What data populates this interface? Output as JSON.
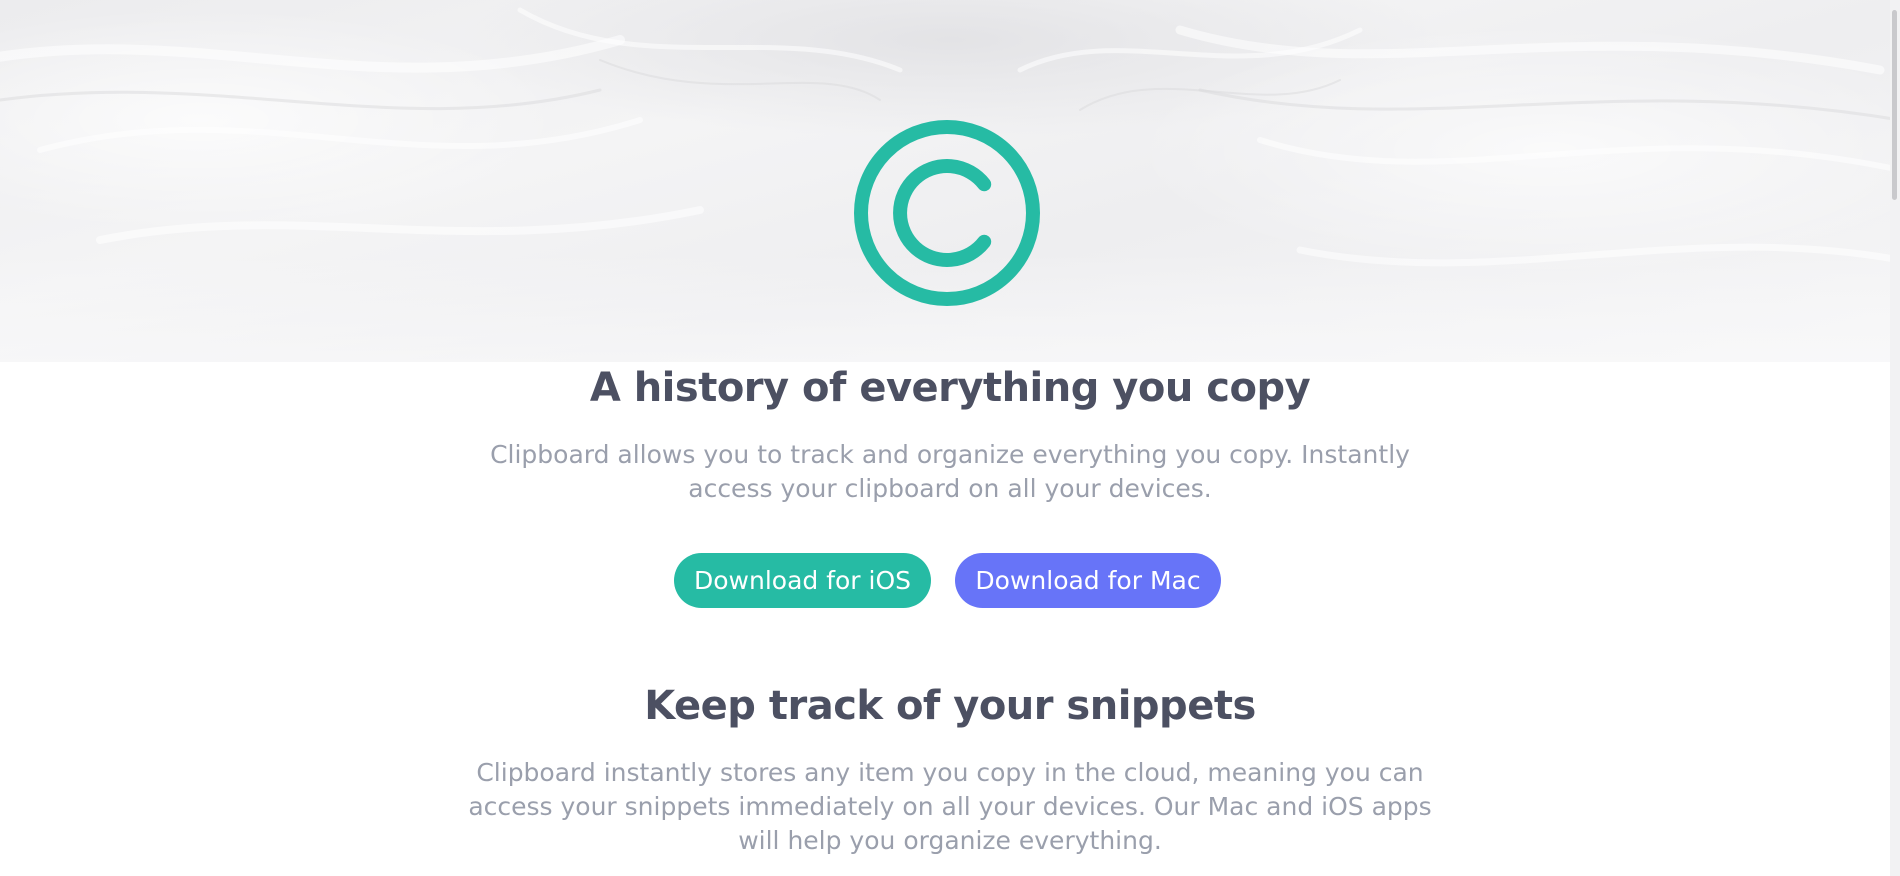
{
  "colors": {
    "brand_teal": "#26BBA4",
    "brand_indigo": "#6774F8",
    "heading": "#4C5062",
    "body_text": "#9A9FAC"
  },
  "hero": {
    "logo_icon": "copyright-c-logo-icon",
    "title": "A history of everything you copy",
    "lead_lines": [
      "Clipboard allows you to track and organize everything you copy. Instantly",
      "access your clipboard on all your devices."
    ],
    "buttons": {
      "ios_label": "Download for iOS",
      "mac_label": "Download for Mac"
    }
  },
  "snippets": {
    "title": "Keep track of your snippets",
    "lead_lines": [
      "Clipboard instantly stores any item you copy in the cloud, meaning you can",
      "access your snippets immediately on all your devices. Our Mac and iOS apps",
      "will help you organize everything."
    ]
  }
}
